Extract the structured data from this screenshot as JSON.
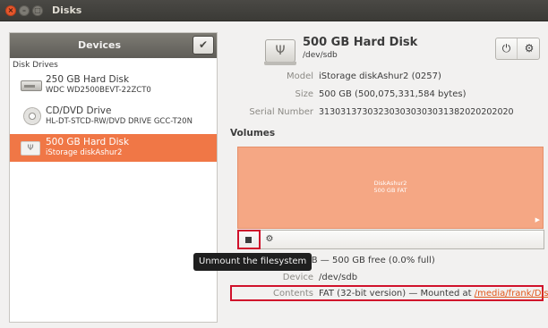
{
  "window": {
    "title": "Disks"
  },
  "devices": {
    "header": "Devices",
    "check_icon": "checkmark-icon",
    "section": "Disk Drives",
    "items": [
      {
        "name": "250 GB Hard Disk",
        "sub": "WDC WD2500BEVT-22ZCT0",
        "icon": "hard-disk-icon"
      },
      {
        "name": "CD/DVD Drive",
        "sub": "HL-DT-STCD-RW/DVD DRIVE GCC-T20N",
        "icon": "optical-drive-icon"
      },
      {
        "name": "500 GB Hard Disk",
        "sub": "iStorage diskAshur2",
        "icon": "usb-disk-icon",
        "selected": true
      }
    ]
  },
  "disk": {
    "title": "500 GB Hard Disk",
    "path": "/dev/sdb",
    "model_label": "Model",
    "model": "iStorage diskAshur2 (0257)",
    "size_label": "Size",
    "size": "500 GB (500,075,331,584 bytes)",
    "serial_label": "Serial Number",
    "serial": "313031373032303030303031382020202020"
  },
  "volumes": {
    "heading": "Volumes",
    "bar_name": "DiskAshur2",
    "bar_size": "500 GB FAT",
    "free_text": "GB — 500 GB free (0.0% full)",
    "device_label": "Device",
    "device": "/dev/sdb",
    "contents_label": "Contents",
    "contents": "FAT (32-bit version) — Mounted at ",
    "mount_link": "/media/frank/Disk..."
  },
  "tooltip": "Unmount the filesystem",
  "colors": {
    "accent": "#f07746",
    "volume": "#f5a784",
    "highlight": "#d0112b"
  }
}
